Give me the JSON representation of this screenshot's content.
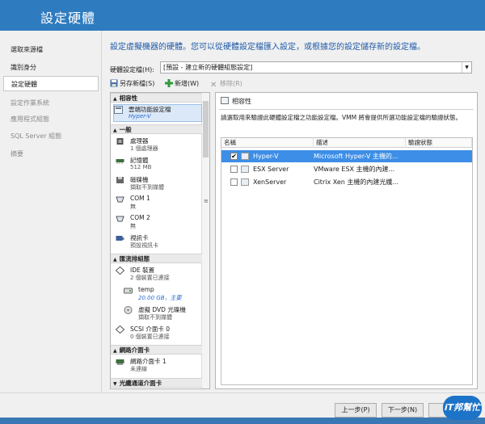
{
  "window": {
    "title": "設定硬體"
  },
  "nav": {
    "items": [
      {
        "label": "選取來源檔"
      },
      {
        "label": "識別身分"
      },
      {
        "label": "設定硬體"
      },
      {
        "label": "設定作業系統"
      },
      {
        "label": "應用程式組態"
      },
      {
        "label": "SQL Server 組態"
      },
      {
        "label": "摘要"
      }
    ]
  },
  "main": {
    "description": "設定虛擬機器的硬體。您可以從硬體設定檔匯入設定，或根據您的設定儲存新的設定檔。",
    "profile_label": "硬體設定檔(H):",
    "profile_value": "[預設 - 建立新的硬體組態設定]"
  },
  "toolbar": {
    "save_as": "另存新檔(S)",
    "new": "新增(W)",
    "remove": "移除(R)"
  },
  "tree": {
    "compat_header": "相容性",
    "compat_item": {
      "label": "雲端功能設定檔",
      "sub": "Hyper-V"
    },
    "general_header": "一般",
    "processor": {
      "label": "處理器",
      "sub": "1 個處理器"
    },
    "memory": {
      "label": "記憶體",
      "sub": "512 MB"
    },
    "floppy": {
      "label": "磁碟機",
      "sub": "擷取不到媒體"
    },
    "com1": {
      "label": "COM 1",
      "sub": "無"
    },
    "com2": {
      "label": "COM 2",
      "sub": "無"
    },
    "video": {
      "label": "視訊卡",
      "sub": "預設視訊卡"
    },
    "bus_header": "匯流排組態",
    "ide": {
      "label": "IDE 裝置",
      "sub": "2 個裝置已連接"
    },
    "temp": {
      "label": "temp",
      "sub": "20.00 GB，主要"
    },
    "dvd": {
      "label": "虛擬 DVD 光碟機",
      "sub": "擷取不到媒體"
    },
    "scsi": {
      "label": "SCSI 介面卡 0",
      "sub": "0 個裝置已連接"
    },
    "net_header": "網路介面卡",
    "nic": {
      "label": "網路介面卡 1",
      "sub": "未連線"
    },
    "next_header": "光纖通道介面卡"
  },
  "panel": {
    "title": "相容性",
    "description": "請選取用來驗證此硬體設定檔之功能設定檔。VMM 將會提供所選功能設定檔的驗證狀態。",
    "columns": [
      "名稱",
      "描述",
      "驗證狀態"
    ],
    "rows": [
      {
        "checked": "✔",
        "name": "Hyper-V",
        "desc": "Microsoft Hyper-V 主機的...",
        "status": ""
      },
      {
        "checked": "",
        "name": "ESX Server",
        "desc": "VMware ESX 主機的內建...",
        "status": ""
      },
      {
        "checked": "",
        "name": "XenServer",
        "desc": "Citrix Xen 主機的內建光纖...",
        "status": ""
      }
    ]
  },
  "footer": {
    "prev": "上一步(P)",
    "next": "下一步(N)",
    "cancel": "取消"
  },
  "watermark": {
    "text": "iT邦幫忙"
  },
  "colors": {
    "title_bar": "#2f7bbf",
    "selection": "#3d8ee6",
    "description_text": "#1e5aa8"
  }
}
